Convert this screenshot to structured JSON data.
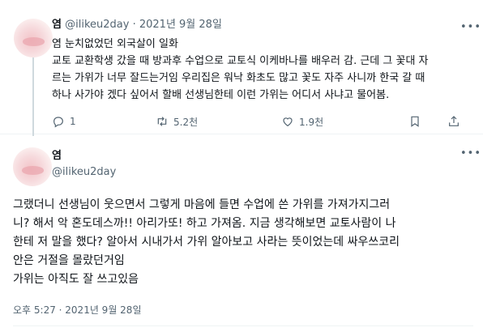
{
  "tweet1": {
    "name": "염",
    "handle": "@ilikeu2day",
    "separator": "·",
    "date": "2021년 9월 28일",
    "lines": [
      "염 눈치없었던 외국살이 일화",
      "교토 교환학생 갔을 때 방과후 수업으로 교토식 이케바나를 배우러 감. 근데 그 꽃대 자",
      "르는 가위가 너무 잘드는거임 우리집은 워낙 화초도 많고 꽃도 자주 사니까 한국 갈 때",
      "하나 사가야 겠다 싶어서 할배 선생님한테 이런 가위는 어디서 사냐고 물어봄."
    ],
    "actions": {
      "reply_count": "1",
      "retweet_count": "5.2천",
      "like_count": "1.9천"
    }
  },
  "tweet2": {
    "name": "염",
    "handle": "@ilikeu2day",
    "lines": [
      "그랬더니 선생님이 웃으면서 그렇게 마음에 들면 수업에 쓴 가위를 가져가지그러",
      "니? 해서 악 혼도데스까!! 아리가또! 하고 가져옴. 지금 생각해보면 교토사람이 나",
      "한테 저 말을 했다? 알아서 시내가서 가위 알아보고 사라는 뜻이었는데 싸우쓰코리",
      "안은 거절을 몰랐던거임",
      "가위는 아직도 잘 쓰고있음"
    ],
    "timestamp": "오후 5:27 · 2021년 9월 28일"
  },
  "icons": {
    "more": "more-icon",
    "reply": "reply-icon",
    "retweet": "retweet-icon",
    "like": "heart-icon",
    "bookmark": "bookmark-icon",
    "share": "share-icon"
  },
  "colors": {
    "text": "#0f1419",
    "secondary": "#536471",
    "divider": "#eff3f4",
    "thread_line": "#cfd9de"
  }
}
